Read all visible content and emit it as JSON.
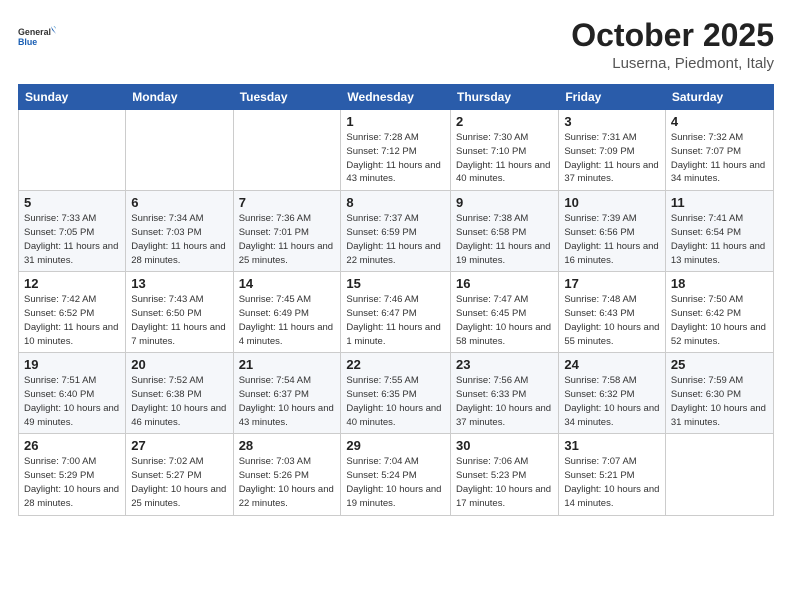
{
  "header": {
    "logo_general": "General",
    "logo_blue": "Blue",
    "title": "October 2025",
    "subtitle": "Luserna, Piedmont, Italy"
  },
  "weekdays": [
    "Sunday",
    "Monday",
    "Tuesday",
    "Wednesday",
    "Thursday",
    "Friday",
    "Saturday"
  ],
  "weeks": [
    [
      {
        "day": "",
        "info": ""
      },
      {
        "day": "",
        "info": ""
      },
      {
        "day": "",
        "info": ""
      },
      {
        "day": "1",
        "info": "Sunrise: 7:28 AM\nSunset: 7:12 PM\nDaylight: 11 hours\nand 43 minutes."
      },
      {
        "day": "2",
        "info": "Sunrise: 7:30 AM\nSunset: 7:10 PM\nDaylight: 11 hours\nand 40 minutes."
      },
      {
        "day": "3",
        "info": "Sunrise: 7:31 AM\nSunset: 7:09 PM\nDaylight: 11 hours\nand 37 minutes."
      },
      {
        "day": "4",
        "info": "Sunrise: 7:32 AM\nSunset: 7:07 PM\nDaylight: 11 hours\nand 34 minutes."
      }
    ],
    [
      {
        "day": "5",
        "info": "Sunrise: 7:33 AM\nSunset: 7:05 PM\nDaylight: 11 hours\nand 31 minutes."
      },
      {
        "day": "6",
        "info": "Sunrise: 7:34 AM\nSunset: 7:03 PM\nDaylight: 11 hours\nand 28 minutes."
      },
      {
        "day": "7",
        "info": "Sunrise: 7:36 AM\nSunset: 7:01 PM\nDaylight: 11 hours\nand 25 minutes."
      },
      {
        "day": "8",
        "info": "Sunrise: 7:37 AM\nSunset: 6:59 PM\nDaylight: 11 hours\nand 22 minutes."
      },
      {
        "day": "9",
        "info": "Sunrise: 7:38 AM\nSunset: 6:58 PM\nDaylight: 11 hours\nand 19 minutes."
      },
      {
        "day": "10",
        "info": "Sunrise: 7:39 AM\nSunset: 6:56 PM\nDaylight: 11 hours\nand 16 minutes."
      },
      {
        "day": "11",
        "info": "Sunrise: 7:41 AM\nSunset: 6:54 PM\nDaylight: 11 hours\nand 13 minutes."
      }
    ],
    [
      {
        "day": "12",
        "info": "Sunrise: 7:42 AM\nSunset: 6:52 PM\nDaylight: 11 hours\nand 10 minutes."
      },
      {
        "day": "13",
        "info": "Sunrise: 7:43 AM\nSunset: 6:50 PM\nDaylight: 11 hours\nand 7 minutes."
      },
      {
        "day": "14",
        "info": "Sunrise: 7:45 AM\nSunset: 6:49 PM\nDaylight: 11 hours\nand 4 minutes."
      },
      {
        "day": "15",
        "info": "Sunrise: 7:46 AM\nSunset: 6:47 PM\nDaylight: 11 hours\nand 1 minute."
      },
      {
        "day": "16",
        "info": "Sunrise: 7:47 AM\nSunset: 6:45 PM\nDaylight: 10 hours\nand 58 minutes."
      },
      {
        "day": "17",
        "info": "Sunrise: 7:48 AM\nSunset: 6:43 PM\nDaylight: 10 hours\nand 55 minutes."
      },
      {
        "day": "18",
        "info": "Sunrise: 7:50 AM\nSunset: 6:42 PM\nDaylight: 10 hours\nand 52 minutes."
      }
    ],
    [
      {
        "day": "19",
        "info": "Sunrise: 7:51 AM\nSunset: 6:40 PM\nDaylight: 10 hours\nand 49 minutes."
      },
      {
        "day": "20",
        "info": "Sunrise: 7:52 AM\nSunset: 6:38 PM\nDaylight: 10 hours\nand 46 minutes."
      },
      {
        "day": "21",
        "info": "Sunrise: 7:54 AM\nSunset: 6:37 PM\nDaylight: 10 hours\nand 43 minutes."
      },
      {
        "day": "22",
        "info": "Sunrise: 7:55 AM\nSunset: 6:35 PM\nDaylight: 10 hours\nand 40 minutes."
      },
      {
        "day": "23",
        "info": "Sunrise: 7:56 AM\nSunset: 6:33 PM\nDaylight: 10 hours\nand 37 minutes."
      },
      {
        "day": "24",
        "info": "Sunrise: 7:58 AM\nSunset: 6:32 PM\nDaylight: 10 hours\nand 34 minutes."
      },
      {
        "day": "25",
        "info": "Sunrise: 7:59 AM\nSunset: 6:30 PM\nDaylight: 10 hours\nand 31 minutes."
      }
    ],
    [
      {
        "day": "26",
        "info": "Sunrise: 7:00 AM\nSunset: 5:29 PM\nDaylight: 10 hours\nand 28 minutes."
      },
      {
        "day": "27",
        "info": "Sunrise: 7:02 AM\nSunset: 5:27 PM\nDaylight: 10 hours\nand 25 minutes."
      },
      {
        "day": "28",
        "info": "Sunrise: 7:03 AM\nSunset: 5:26 PM\nDaylight: 10 hours\nand 22 minutes."
      },
      {
        "day": "29",
        "info": "Sunrise: 7:04 AM\nSunset: 5:24 PM\nDaylight: 10 hours\nand 19 minutes."
      },
      {
        "day": "30",
        "info": "Sunrise: 7:06 AM\nSunset: 5:23 PM\nDaylight: 10 hours\nand 17 minutes."
      },
      {
        "day": "31",
        "info": "Sunrise: 7:07 AM\nSunset: 5:21 PM\nDaylight: 10 hours\nand 14 minutes."
      },
      {
        "day": "",
        "info": ""
      }
    ]
  ]
}
